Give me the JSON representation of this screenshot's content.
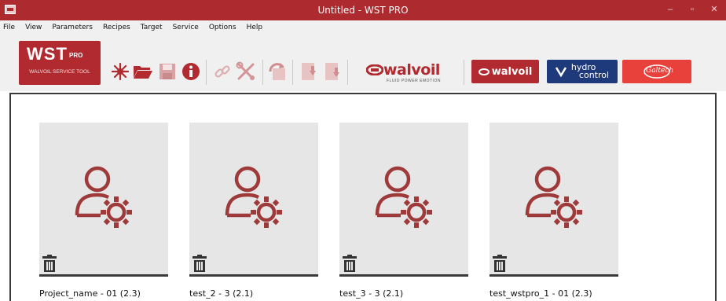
{
  "window": {
    "title": "Untitled - WST PRO",
    "buttons": [
      "–",
      "▫",
      "✕"
    ]
  },
  "menu": [
    "File",
    "View",
    "Parameters",
    "Recipes",
    "Target",
    "Service",
    "Options",
    "Help"
  ],
  "logo": {
    "name": "WST",
    "suffix": "PRO",
    "subtitle": "WALVOIL SERVICE TOOL"
  },
  "toolbar": {
    "icons": [
      "new-icon",
      "open-folder-icon",
      "save-icon",
      "info-icon",
      "connect-icon",
      "tools-icon",
      "refresh-icon",
      "upload-icon",
      "download-icon"
    ]
  },
  "brands": {
    "walvoil_text": "walvoil",
    "walvoil_tagline": "FLUID POWER EMOTION",
    "walvoil_button": "walvoil",
    "hydrocontrol_line1": "hydro",
    "hydrocontrol_line2": "control",
    "galtech": "Galtech"
  },
  "colors": {
    "brand_red": "#b02a30",
    "hydro_blue": "#1f3a7a",
    "galtech_red": "#e8403a",
    "tile_bg": "#e6e6e6"
  },
  "projects": [
    {
      "label": "Project_name - 01 (2.3)"
    },
    {
      "label": "test_2 - 3 (2.1)"
    },
    {
      "label": "test_3 - 3 (2.1)"
    },
    {
      "label": "test_wstpro_1 - 01 (2.3)"
    }
  ]
}
